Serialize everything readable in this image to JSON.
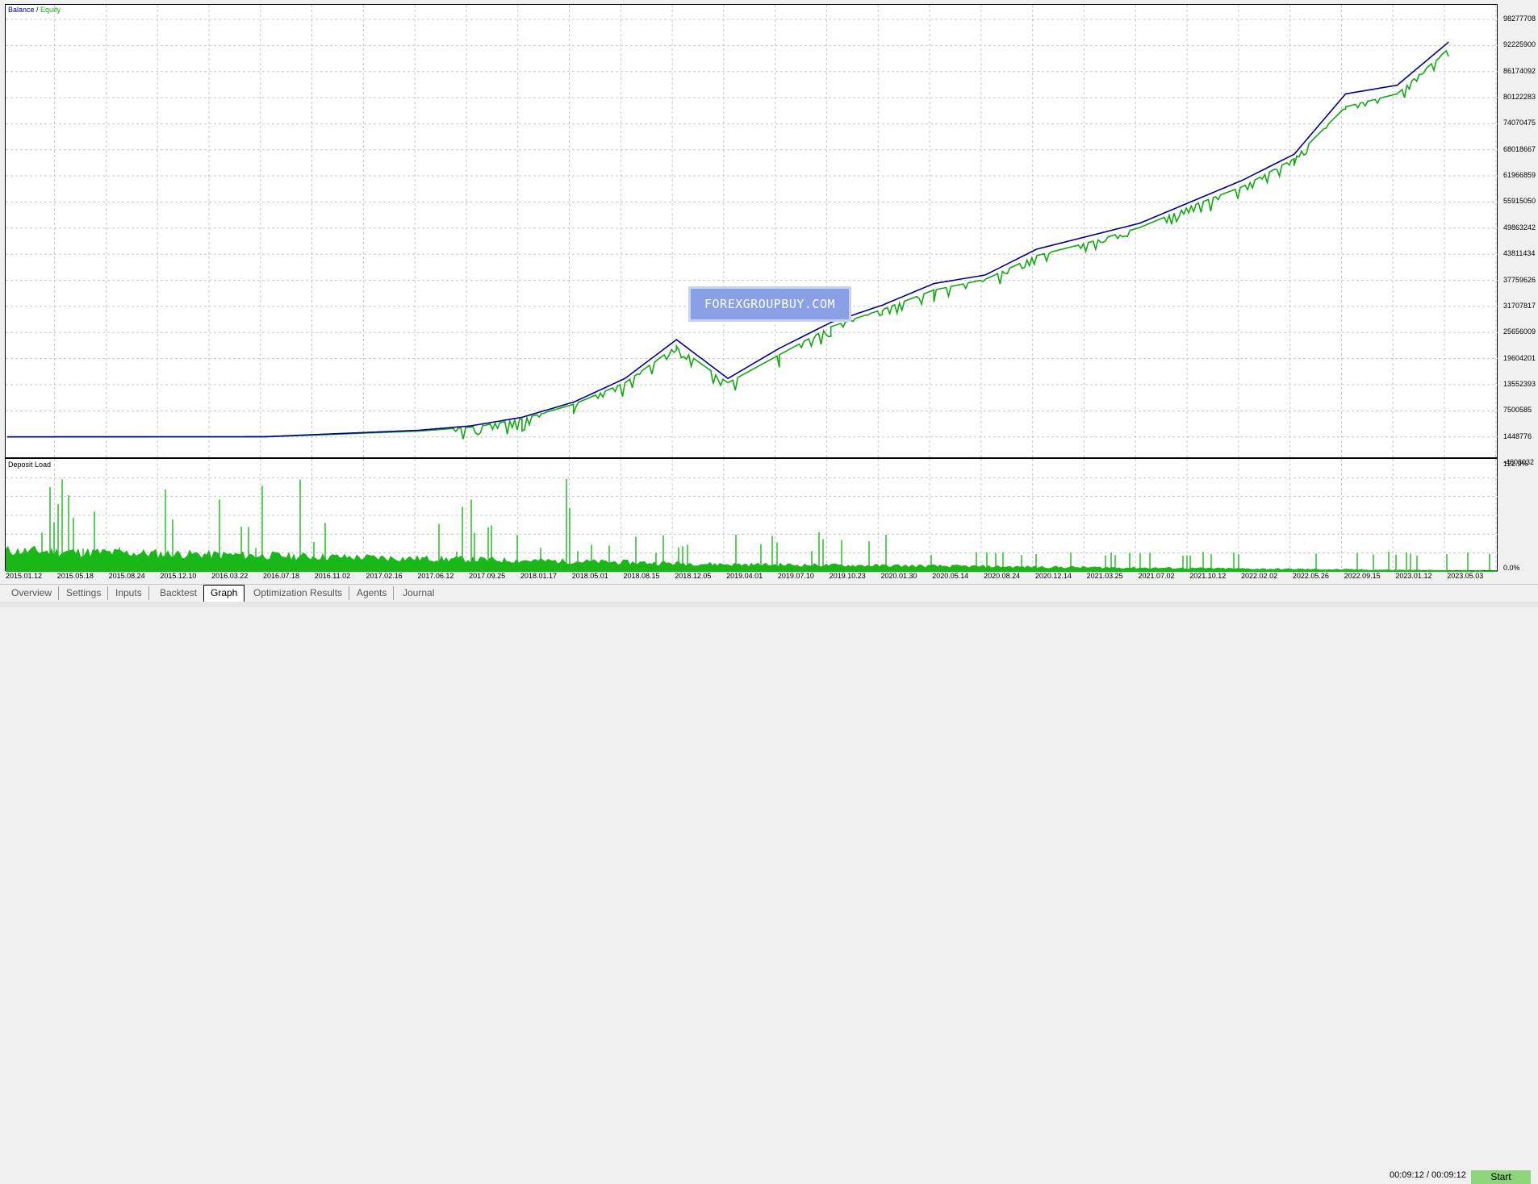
{
  "main_chart": {
    "legend_balance": "Balance",
    "legend_sep": " / ",
    "legend_equity": "Equity",
    "y_labels": [
      "98277708",
      "92225900",
      "86174092",
      "80122283",
      "74070475",
      "68018667",
      "61966859",
      "55915050",
      "49863242",
      "43811434",
      "37759626",
      "31707817",
      "25656009",
      "19604201",
      "13552393",
      "7500585",
      "1448776",
      "-4603032"
    ]
  },
  "load_chart": {
    "title": "Deposit Load",
    "y_top": "122.9%",
    "y_bottom": "0.0%"
  },
  "x_labels": [
    "2015.01.12",
    "2015.05.18",
    "2015.08.24",
    "2015.12.10",
    "2016.03.22",
    "2016.07.18",
    "2016.11.02",
    "2017.02.16",
    "2017.06.12",
    "2017.09.25",
    "2018.01.17",
    "2018.05.01",
    "2018.08.15",
    "2018.12.05",
    "2019.04.01",
    "2019.07.10",
    "2019.10.23",
    "2020.01.30",
    "2020.05.14",
    "2020.08.24",
    "2020.12.14",
    "2021.03.25",
    "2021.07.02",
    "2021.10.12",
    "2022.02.02",
    "2022.05.26",
    "2022.09.15",
    "2023.01.12",
    "2023.05.03"
  ],
  "watermark": "FOREXGROUPBUY.COM",
  "tabs": [
    "Overview",
    "Settings",
    "Inputs",
    "Backtest",
    "Graph",
    "Optimization Results",
    "Agents",
    "Journal"
  ],
  "active_tab": "Graph",
  "timer": "00:09:12 / 00:09:12",
  "start_button": "Start",
  "colors": {
    "balance": "#00008b",
    "equity": "#12a812",
    "load": "#18b818",
    "grid": "#c8c8c8"
  },
  "chart_data": [
    {
      "type": "line",
      "title": "",
      "series": [
        {
          "name": "Balance",
          "x": [
            "2015.01.12",
            "2016.07.18",
            "2017.06.12",
            "2017.09.25",
            "2018.01.17",
            "2018.05.01",
            "2018.08.15",
            "2018.12.05",
            "2019.04.01",
            "2019.07.10",
            "2019.10.23",
            "2020.01.30",
            "2020.05.14",
            "2020.08.24",
            "2020.12.14",
            "2021.03.25",
            "2021.07.02",
            "2021.10.12",
            "2022.02.02",
            "2022.05.26",
            "2022.09.15",
            "2023.01.12",
            "2023.05.03"
          ],
          "values": [
            1448776,
            1500000,
            3000000,
            4000000,
            6000000,
            9500000,
            15000000,
            24000000,
            15000000,
            22000000,
            28000000,
            32000000,
            37000000,
            39000000,
            45000000,
            48000000,
            51000000,
            56000000,
            61000000,
            67000000,
            81000000,
            83000000,
            93000000
          ]
        },
        {
          "name": "Equity",
          "x": [
            "2015.01.12",
            "2016.07.18",
            "2017.06.12",
            "2017.09.25",
            "2018.01.17",
            "2018.05.01",
            "2018.08.15",
            "2018.12.05",
            "2019.04.01",
            "2019.07.10",
            "2019.10.23",
            "2020.01.30",
            "2020.05.14",
            "2020.08.24",
            "2020.12.14",
            "2021.03.25",
            "2021.07.02",
            "2021.10.12",
            "2022.02.02",
            "2022.05.26",
            "2022.09.15",
            "2023.01.12",
            "2023.05.03"
          ],
          "values": [
            1448776,
            1450000,
            2800000,
            3700000,
            5600000,
            9000000,
            14000000,
            22500000,
            14000000,
            20500000,
            27000000,
            31000000,
            35500000,
            38000000,
            43500000,
            46500000,
            50000000,
            55000000,
            59500000,
            66000000,
            78000000,
            81000000,
            91500000
          ]
        }
      ],
      "ylim": [
        -4603032,
        98277708
      ],
      "grid": true,
      "legend": "top-left"
    },
    {
      "type": "bar",
      "title": "Deposit Load",
      "ylim": [
        0,
        122.9
      ],
      "ylabel_unit": "%",
      "grid": true
    }
  ]
}
